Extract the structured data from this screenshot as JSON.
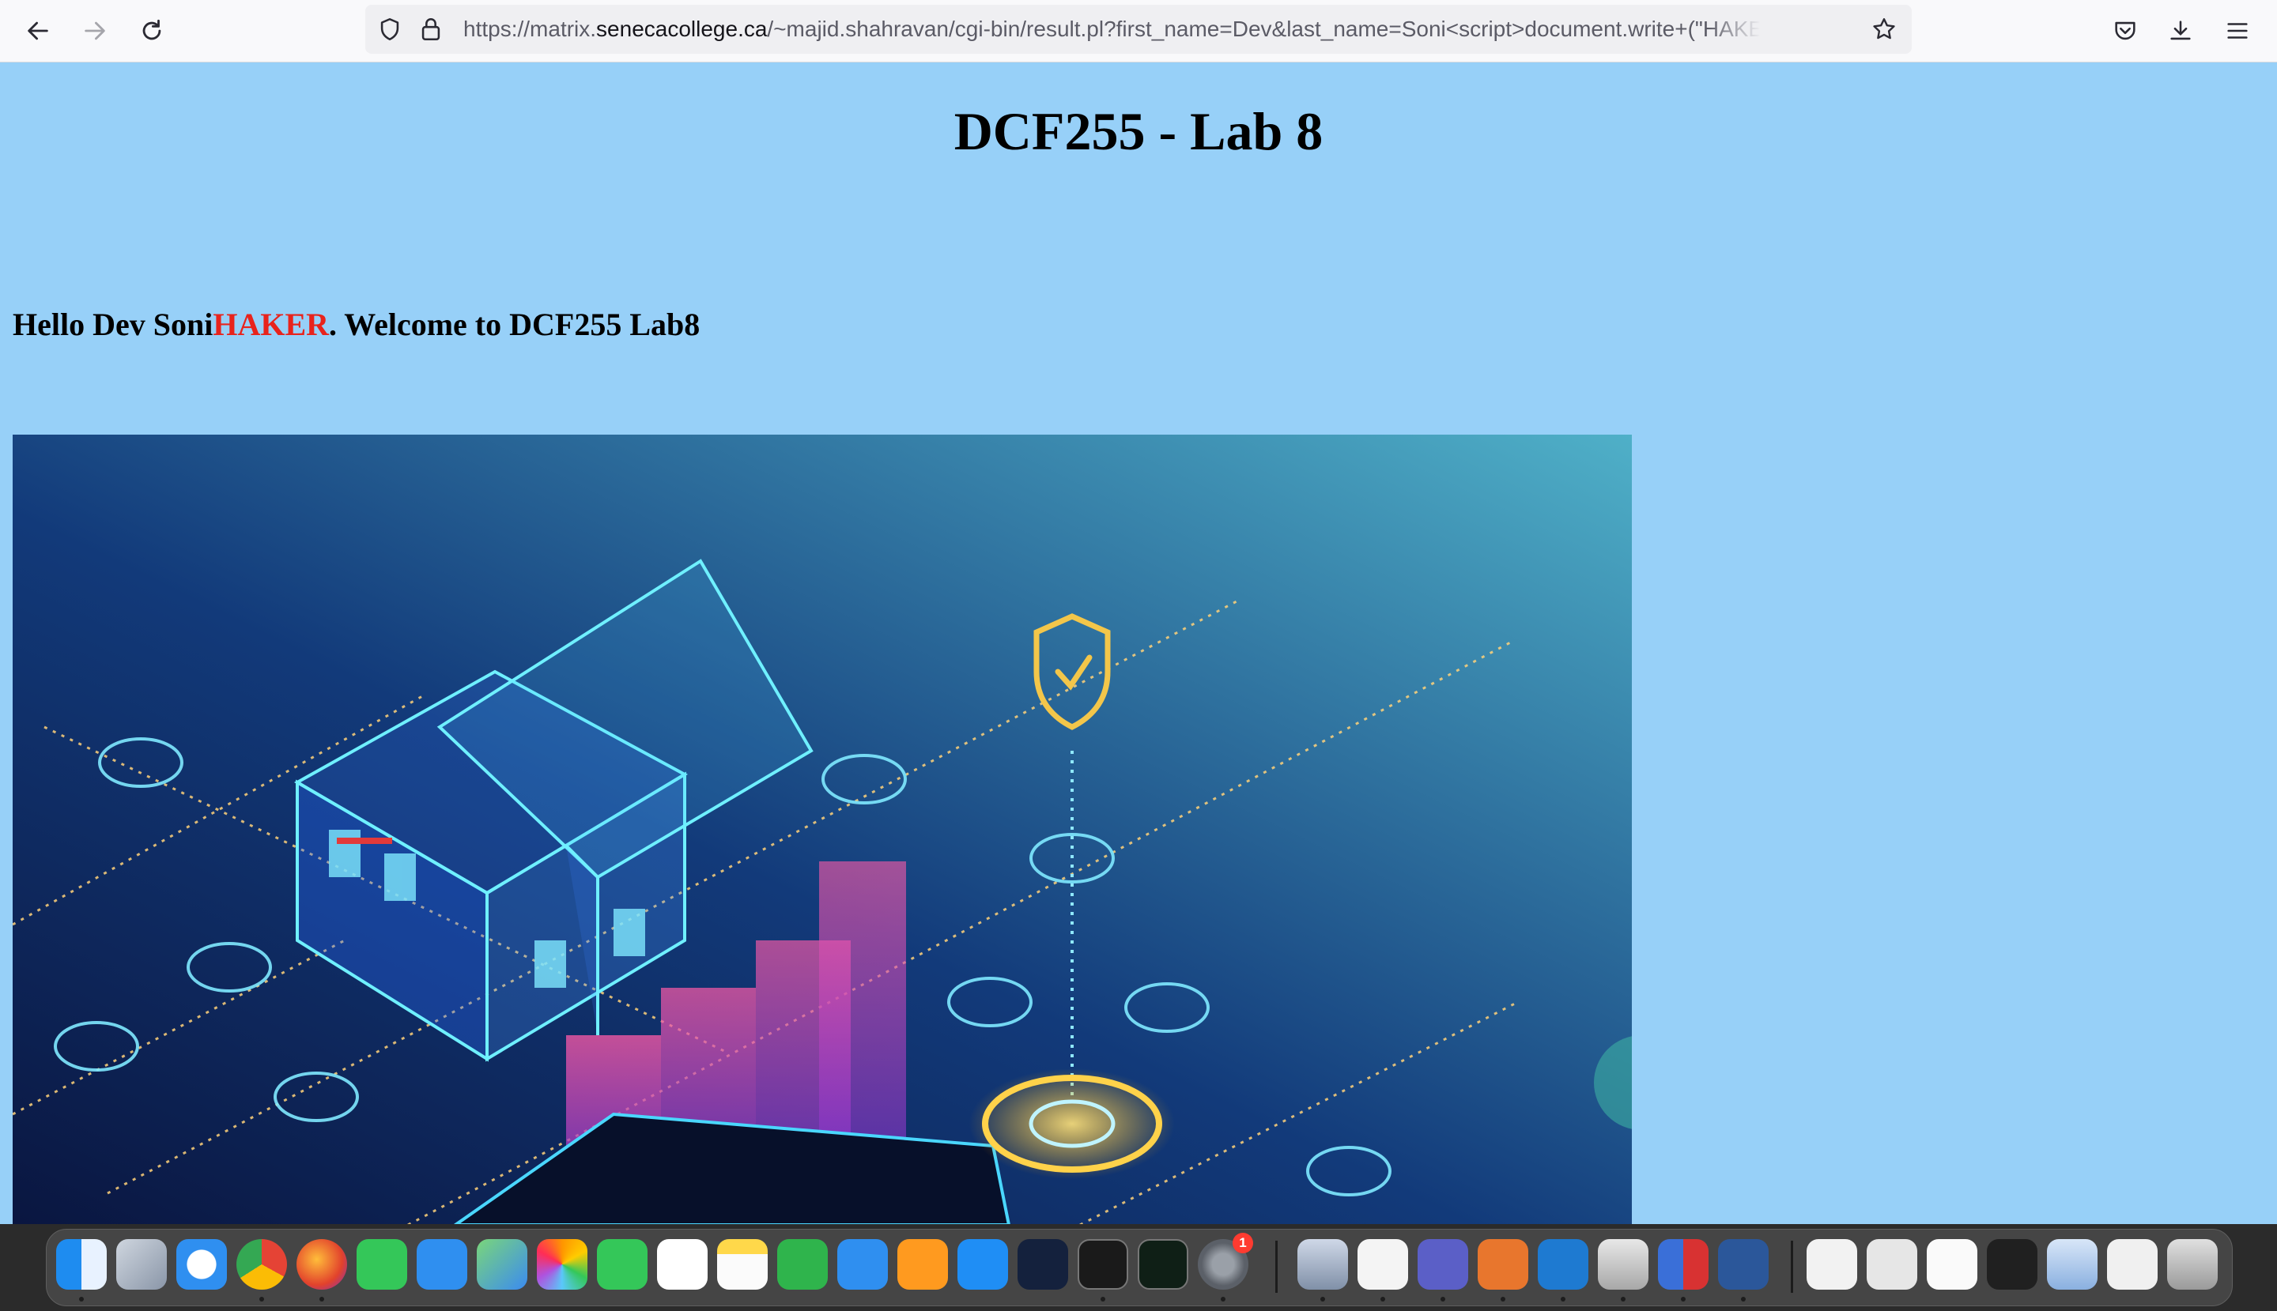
{
  "browser": {
    "url_prefix": "https://matrix.",
    "url_host": "senecacollege.ca",
    "url_path": "/~majid.shahravan/cgi-bin/result.pl?first_name=Dev&last_name=Soni<script>document.write+(\"HAKER\",f"
  },
  "page": {
    "title": "DCF255 - Lab 8",
    "greeting_before": "Hello Dev Soni",
    "greeting_injected": "HAKER",
    "greeting_after": ". Welcome to DCF255 Lab8"
  },
  "dock": {
    "system_preferences_badge": "1"
  },
  "colors": {
    "page_background": "#97d0f8",
    "injected_text": "#e8231c"
  }
}
